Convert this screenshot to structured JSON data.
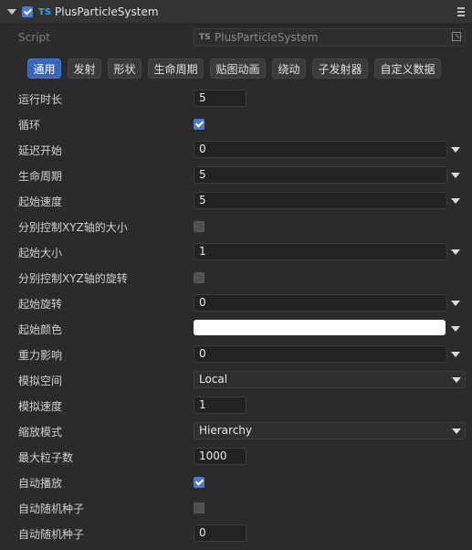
{
  "header": {
    "title": "PlusParticleSystem",
    "enabled": true,
    "type_badge": "TS"
  },
  "script": {
    "label": "Script",
    "type_badge": "TS",
    "value": "PlusParticleSystem"
  },
  "tabs": [
    {
      "label": "通用",
      "active": true
    },
    {
      "label": "发射",
      "active": false
    },
    {
      "label": "形状",
      "active": false
    },
    {
      "label": "生命周期",
      "active": false
    },
    {
      "label": "贴图动画",
      "active": false
    },
    {
      "label": "绕动",
      "active": false
    },
    {
      "label": "子发射器",
      "active": false
    },
    {
      "label": "自定义数据",
      "active": false
    }
  ],
  "properties": [
    {
      "label": "运行时长",
      "value": "5"
    },
    {
      "label": "循环",
      "checked": true
    },
    {
      "label": "延迟开始",
      "value": "0"
    },
    {
      "label": "生命周期",
      "value": "5"
    },
    {
      "label": "起始速度",
      "value": "5"
    },
    {
      "label": "分别控制XYZ轴的大小",
      "checked": false
    },
    {
      "label": "起始大小",
      "value": "1"
    },
    {
      "label": "分别控制XYZ轴的旋转",
      "checked": false
    },
    {
      "label": "起始旋转",
      "value": "0"
    },
    {
      "label": "起始颜色",
      "color": "#ffffff"
    },
    {
      "label": "重力影响",
      "value": "0"
    },
    {
      "label": "模拟空间",
      "value": "Local"
    },
    {
      "label": "模拟速度",
      "value": "1"
    },
    {
      "label": "缩放模式",
      "value": "Hierarchy"
    },
    {
      "label": "最大粒子数",
      "value": "1000"
    },
    {
      "label": "自动播放",
      "checked": true
    },
    {
      "label": "自动随机种子",
      "checked": false
    },
    {
      "label": "自动随机种子",
      "value": "0"
    }
  ],
  "colors": {
    "accent": "#3a66b8",
    "checkbox_on": "#4d78cc",
    "ts_badge": "#3b9cf0"
  }
}
